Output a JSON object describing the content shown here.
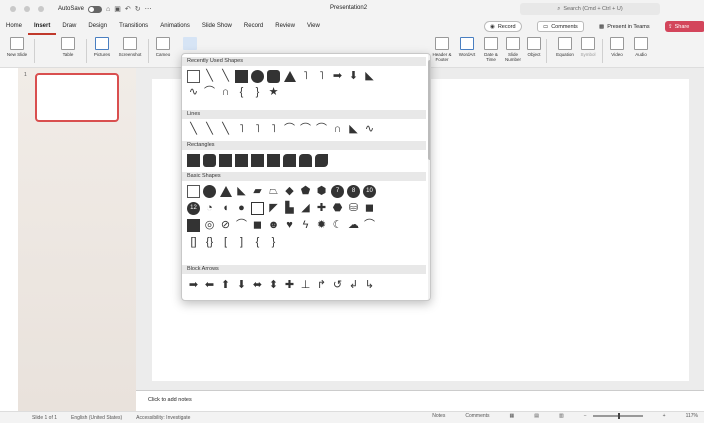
{
  "titlebar": {
    "autosave_label": "AutoSave",
    "title": "Presentation2",
    "search_placeholder": "Search (Cmd + Ctrl + U)"
  },
  "tabs": [
    "Home",
    "Insert",
    "Draw",
    "Design",
    "Transitions",
    "Animations",
    "Slide Show",
    "Record",
    "Review",
    "View"
  ],
  "active_tab": "Insert",
  "header_buttons": {
    "record": "Record",
    "comments": "Comments",
    "teams": "Present in Teams",
    "share": "Share"
  },
  "ribbon": {
    "new_slide": "New Slide",
    "table": "Table",
    "pictures": "Pictures",
    "screenshot": "Screenshot",
    "cameo": "Cameo",
    "header_footer": "Header & Footer",
    "wordart": "WordArt",
    "date_time": "Date & Time",
    "slide_number": "Slide Number",
    "object": "Object",
    "equation": "Equation",
    "symbol": "Symbol",
    "video": "Video",
    "audio": "Audio"
  },
  "slides_panel": {
    "slide_number": "1"
  },
  "notes_placeholder": "Click to add notes",
  "status": {
    "slide": "Slide 1 of 1",
    "language": "English (United States)",
    "accessibility": "Accessibility: Investigate",
    "notes": "Notes",
    "comments": "Comments",
    "zoom": "117%"
  },
  "shapes_menu": {
    "recent": "Recently Used Shapes",
    "lines": "Lines",
    "rectangles": "Rectangles",
    "basic": "Basic Shapes",
    "block_arrows": "Block Arrows"
  },
  "colors": {
    "accent": "#c0392b",
    "share": "#d3455b"
  }
}
